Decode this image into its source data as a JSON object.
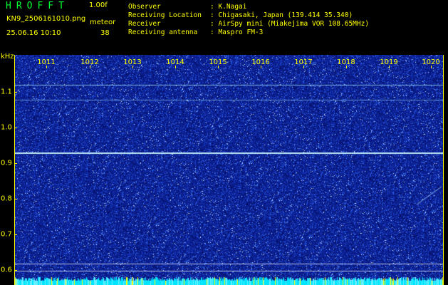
{
  "header": {
    "app_title": "HROFFT",
    "version": "1.00f",
    "filename": "KN9_2506161010.png",
    "meteor_label": "meteor",
    "timestamp": "25.06.16 10:10",
    "meteor_count": "38"
  },
  "info": [
    {
      "label": "Observer",
      "value": ": K.Nagai"
    },
    {
      "label": "Receiving Location",
      "value": ": Chigasaki, Japan (139.414 35.340)"
    },
    {
      "label": "Receiver",
      "value": ": AirSpy mini (Miakejima VOR 108.65MHz)"
    },
    {
      "label": "Receiving antenna",
      "value": ": Maspro FM-3"
    }
  ],
  "plot": {
    "unit": "kHz",
    "x_ticks": [
      "1011",
      "1012",
      "1013",
      "1014",
      "1015",
      "1016",
      "1017",
      "1018",
      "1019",
      "1020"
    ],
    "y_ticks": [
      "1.1",
      "1.0",
      "0.9",
      "0.8",
      "0.7",
      "0.6"
    ],
    "colors": {
      "background": "#0a1e8e",
      "noise": "#3a6cff",
      "trace": "#c8f0ff",
      "labels": "#ffff00",
      "bottom_band": "#00e5ff"
    }
  }
}
